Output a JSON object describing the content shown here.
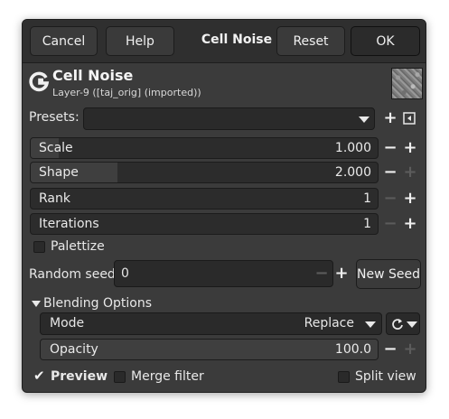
{
  "header": {
    "cancel_label": "Cancel",
    "help_label": "Help",
    "title": "Cell Noise",
    "reset_label": "Reset",
    "ok_label": "OK"
  },
  "operation": {
    "title": "Cell Noise",
    "subtitle": "Layer-9 ([taj_orig] (imported))"
  },
  "presets": {
    "label": "Presets:",
    "value": ""
  },
  "sliders": [
    {
      "label": "Scale",
      "value": "1.000",
      "fill": 0.08
    },
    {
      "label": "Shape",
      "value": "2.000",
      "fill": 0.25
    },
    {
      "label": "Rank",
      "value": "1",
      "fill": 0.0
    },
    {
      "label": "Iterations",
      "value": "1",
      "fill": 0.0
    }
  ],
  "palettize": {
    "label": "Palettize",
    "checked": false
  },
  "random_seed": {
    "label": "Random seed",
    "value": "0",
    "new_seed_label": "New Seed"
  },
  "blending": {
    "section_label": "Blending Options",
    "mode_label": "Mode",
    "mode_value": "Replace",
    "opacity_label": "Opacity",
    "opacity_value": "100.0",
    "opacity_fill": 1.0
  },
  "footer": {
    "preview_label": "Preview",
    "preview_checked": true,
    "merge_label": "Merge filter",
    "merge_checked": false,
    "split_label": "Split view",
    "split_checked": false
  },
  "colors": {
    "dialog_bg": "#3b3b3b",
    "header_bg": "#2f2f2f",
    "field_bg": "#2a2a2a",
    "text": "#e6e6e6"
  }
}
